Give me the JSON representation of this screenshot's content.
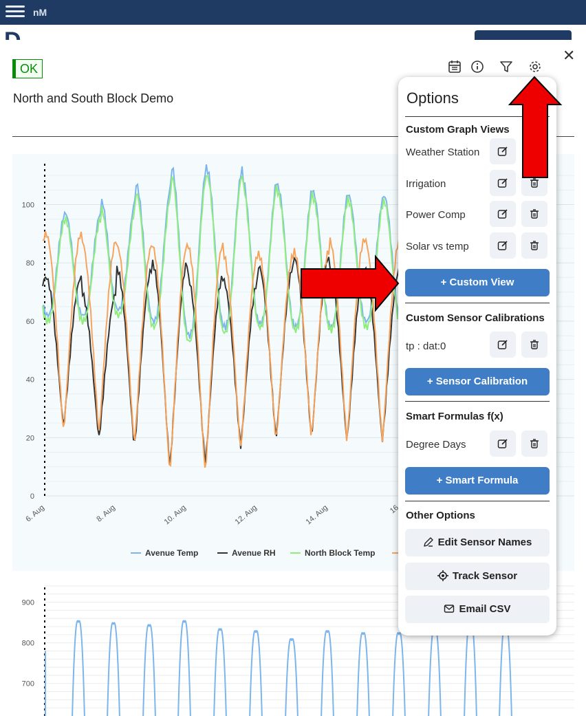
{
  "app": {
    "brand": "nM"
  },
  "status": {
    "badge": "OK"
  },
  "page": {
    "title": "North and South Block Demo"
  },
  "options": {
    "title": "Options",
    "graph_views": {
      "header": "Custom Graph Views",
      "items": [
        "Weather Station",
        "Irrigation",
        "Power Comp",
        "Solar vs temp"
      ],
      "add_label": "+ Custom View"
    },
    "calibrations": {
      "header": "Custom Sensor Calibrations",
      "items": [
        "tp : dat:0"
      ],
      "add_label": "+ Sensor Calibration"
    },
    "formulas": {
      "header": "Smart Formulas f(x)",
      "items": [
        "Degree Days"
      ],
      "add_label": "+ Smart Formula"
    },
    "other": {
      "header": "Other Options",
      "edit_names": "Edit Sensor Names",
      "track_sensor": "Track Sensor",
      "email_csv": "Email CSV"
    }
  },
  "colors": {
    "topbar": "#1f3b63",
    "primary_button": "#3f7dc6",
    "ok_green": "#0a8a0a",
    "annotation_arrow": "#ee0000"
  },
  "chart_data": [
    {
      "type": "line",
      "ylim": [
        0,
        115
      ],
      "yticks": [
        0,
        20,
        40,
        60,
        80,
        100
      ],
      "x_ticks": [
        "6. Aug",
        "8. Aug",
        "10. Aug",
        "12. Aug",
        "14. Aug",
        "16"
      ],
      "grid": true,
      "legend": "bottom",
      "series": [
        {
          "name": "Avenue Temp",
          "color": "#7cb5ec",
          "peaks": [
            97,
            102,
            107,
            113,
            112,
            109,
            106,
            104,
            103
          ],
          "troughs": [
            62,
            64,
            60,
            55,
            58,
            59,
            58,
            58,
            60
          ]
        },
        {
          "name": "Avenue RH",
          "color": "#333333",
          "peaks": [
            75,
            70,
            78,
            80,
            75,
            74,
            79,
            82,
            78
          ],
          "troughs": [
            24,
            20,
            17,
            10,
            11,
            17,
            20,
            20,
            19
          ]
        },
        {
          "name": "North Block Temp",
          "color": "#90ed7d",
          "peaks": [
            95,
            99,
            104,
            110,
            110,
            107,
            104,
            102,
            101
          ],
          "troughs": [
            60,
            62,
            58,
            53,
            56,
            58,
            57,
            57,
            58
          ]
        },
        {
          "name": "",
          "color": "#f7a35c",
          "peaks": [
            90,
            88,
            86,
            86,
            86,
            83,
            83,
            84,
            88
          ],
          "troughs": [
            22,
            22,
            18,
            8,
            8,
            16,
            19,
            20,
            19
          ]
        }
      ]
    },
    {
      "type": "line",
      "yticks": [
        700,
        800,
        900
      ],
      "grid": true,
      "series": [
        {
          "name": "",
          "color": "#7cb5ec",
          "peaks": [
            850,
            845,
            840,
            850,
            830,
            825,
            805,
            825,
            820,
            820,
            830,
            850,
            840
          ]
        }
      ]
    }
  ]
}
